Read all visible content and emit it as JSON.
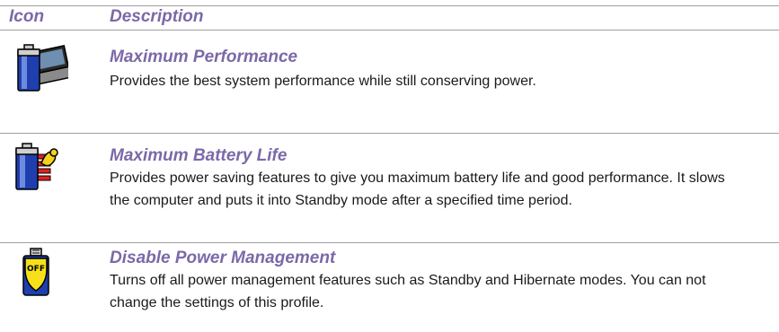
{
  "header": {
    "icon_col": "Icon",
    "description_col": "Description"
  },
  "rows": [
    {
      "icon": "battery-laptop-icon",
      "title": "Maximum Performance",
      "description": "Provides the best system performance while still conserving power."
    },
    {
      "icon": "battery-flexed-arm-icon",
      "title": "Maximum Battery Life",
      "description": "Provides power saving features to give you maximum battery life and good performance. It slows the computer and puts it into Standby mode after a specified time period."
    },
    {
      "icon": "battery-off-icon",
      "title": "Disable Power Management",
      "description": "Turns off all power management features such as Standby and Hibernate modes. You can not change the settings of this profile."
    }
  ],
  "colors": {
    "accent": "#7b69a8",
    "rule": "#a0a0a0",
    "text": "#1a1a1a"
  }
}
